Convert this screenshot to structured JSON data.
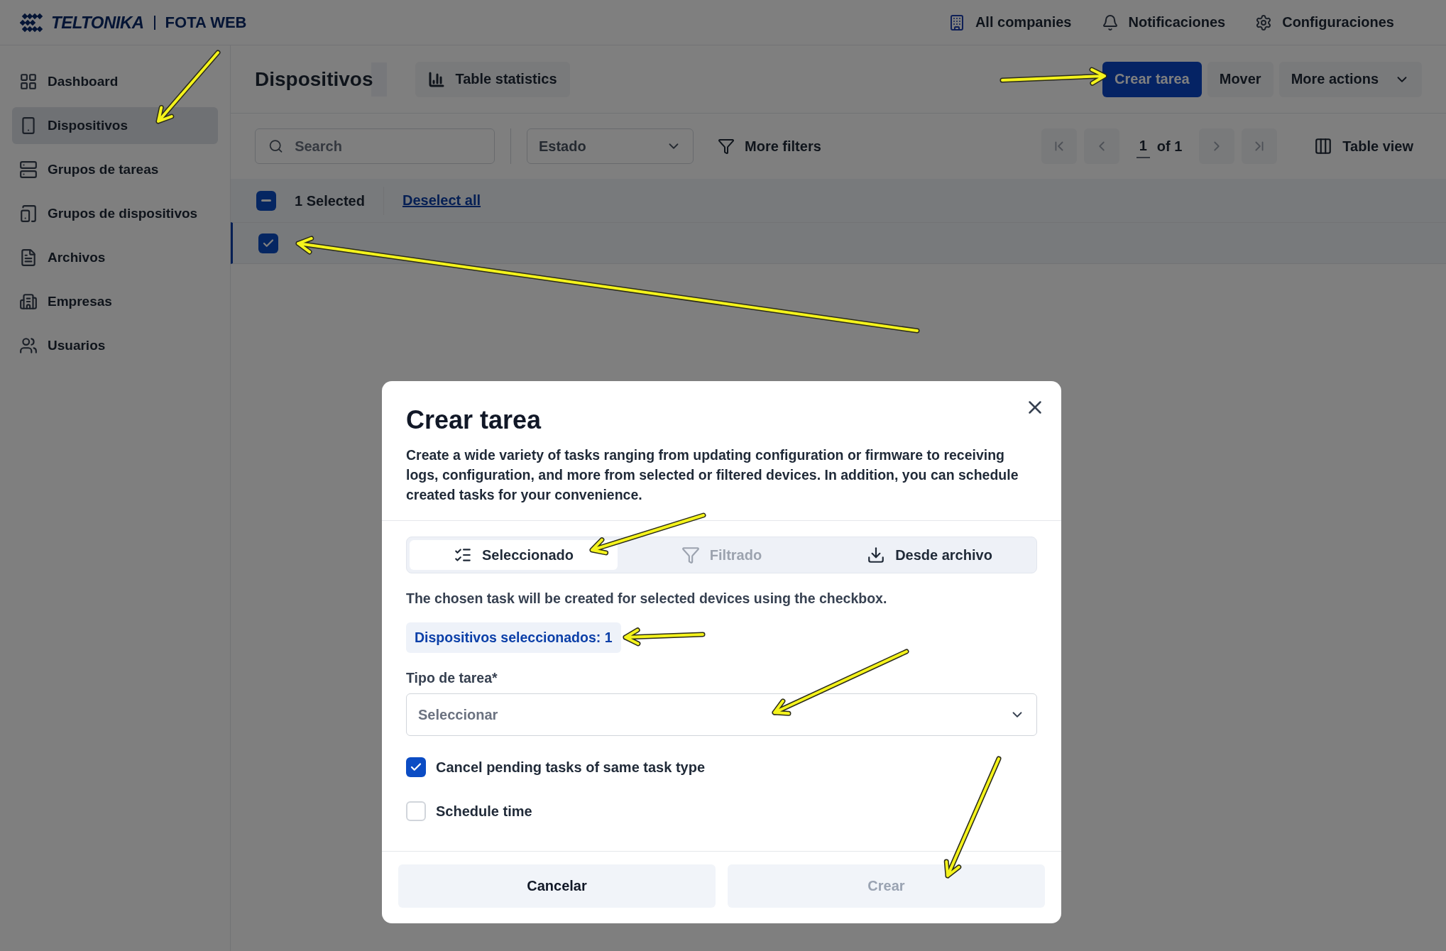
{
  "header": {
    "logo": "TELTONIKA",
    "product": "FOTA WEB",
    "actions": [
      {
        "label": "All companies"
      },
      {
        "label": "Notificaciones"
      },
      {
        "label": "Configuraciones"
      }
    ]
  },
  "sidebar": {
    "items": [
      {
        "label": "Dashboard",
        "selected": false
      },
      {
        "label": "Dispositivos",
        "selected": true
      },
      {
        "label": "Grupos de tareas",
        "selected": false
      },
      {
        "label": "Grupos de dispositivos",
        "selected": false
      },
      {
        "label": "Archivos",
        "selected": false
      },
      {
        "label": "Empresas",
        "selected": false
      },
      {
        "label": "Usuarios",
        "selected": false
      }
    ]
  },
  "page": {
    "title": "Dispositivos",
    "stats_button": "Table statistics",
    "actions": [
      {
        "label": "Crear tarea",
        "primary": true,
        "menu": false
      },
      {
        "label": "Mover",
        "primary": false,
        "menu": false
      },
      {
        "label": "More actions",
        "primary": false,
        "menu": true
      }
    ]
  },
  "filters": {
    "search_placeholder": "Search",
    "status_select": "Estado",
    "more_filters": "More filters",
    "page": "1",
    "page_total": "of 1",
    "view": "Table view"
  },
  "selection": {
    "indeterminate": true,
    "count": "1 Selected",
    "deselect": "Deselect all"
  },
  "rows": [
    {
      "checked": true
    }
  ],
  "modal": {
    "title": "Crear tarea",
    "description": "Create a wide variety of tasks ranging from updating configuration or firmware to receiving logs, configuration, and more from selected or filtered devices. In addition, you can schedule created tasks for your convenience.",
    "tabs": [
      {
        "label": "Seleccionado",
        "selected": true,
        "disabled": false
      },
      {
        "label": "Filtrado",
        "selected": false,
        "disabled": true
      },
      {
        "label": "Desde archivo",
        "selected": false,
        "disabled": false
      }
    ],
    "info": "The chosen task will be created for selected devices using the checkbox.",
    "badge": "Dispositivos seleccionados: 1",
    "task_type": {
      "label": "Tipo de tarea*",
      "placeholder": "Seleccionar"
    },
    "options": [
      {
        "label": "Cancel pending tasks of same task type",
        "checked": true
      },
      {
        "label": "Schedule time",
        "checked": false
      }
    ],
    "buttons": [
      {
        "label": "Cancelar",
        "disabled": false
      },
      {
        "label": "Crear",
        "disabled": true
      }
    ]
  }
}
